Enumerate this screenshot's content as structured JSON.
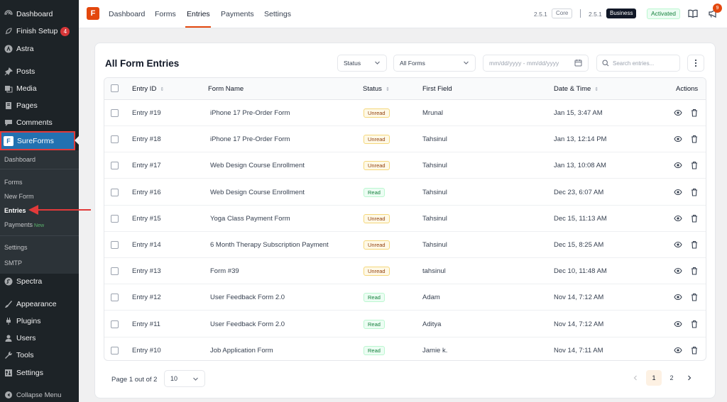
{
  "sidebar": {
    "items": [
      {
        "label": "Dashboard",
        "icon": "dashboard-icon"
      },
      {
        "label": "Finish Setup",
        "icon": "rocket-icon",
        "badge": "4"
      },
      {
        "label": "Astra",
        "icon": "astra-icon"
      },
      {
        "label": "Posts",
        "icon": "pin-icon"
      },
      {
        "label": "Media",
        "icon": "media-icon"
      },
      {
        "label": "Pages",
        "icon": "page-icon"
      },
      {
        "label": "Comments",
        "icon": "comment-icon"
      }
    ],
    "active": {
      "label": "SureForms",
      "icon": "sureforms-icon"
    },
    "submenu": {
      "dashboard": "Dashboard",
      "forms": "Forms",
      "new_form": "New Form",
      "entries": "Entries",
      "payments": "Payments",
      "payments_tag": "New",
      "settings": "Settings",
      "smtp": "SMTP"
    },
    "lower_items": [
      {
        "label": "Spectra",
        "icon": "spectra-icon"
      },
      {
        "label": "Appearance",
        "icon": "brush-icon"
      },
      {
        "label": "Plugins",
        "icon": "plugin-icon"
      },
      {
        "label": "Users",
        "icon": "users-icon"
      },
      {
        "label": "Tools",
        "icon": "wrench-icon"
      },
      {
        "label": "Settings",
        "icon": "settings-icon"
      },
      {
        "label": "Collapse Menu",
        "icon": "collapse-icon"
      }
    ]
  },
  "topbar": {
    "nav": [
      "Dashboard",
      "Forms",
      "Entries",
      "Payments",
      "Settings"
    ],
    "active_nav": "Entries",
    "core_version": "2.5.1",
    "core_label": "Core",
    "biz_version": "2.5.1",
    "biz_label": "Business",
    "status": "Activated",
    "notifications": "9",
    "accent": "#e3470d"
  },
  "entries": {
    "title": "All Form Entries",
    "filters": {
      "status": "Status",
      "forms": "All Forms",
      "date_placeholder": "mm/dd/yyyy - mm/dd/yyyy",
      "search_placeholder": "Search entries..."
    },
    "columns": {
      "id": "Entry ID",
      "form": "Form Name",
      "status": "Status",
      "first": "First Field",
      "date": "Date & Time",
      "actions": "Actions"
    },
    "rows": [
      {
        "id": "Entry #19",
        "form": "iPhone 17 Pre-Order Form",
        "status": "Unread",
        "first": "Mrunal",
        "date": "Jan 15, 3:47 AM"
      },
      {
        "id": "Entry #18",
        "form": "iPhone 17 Pre-Order Form",
        "status": "Unread",
        "first": "Tahsinul",
        "date": "Jan 13, 12:14 PM"
      },
      {
        "id": "Entry #17",
        "form": "Web Design Course Enrollment",
        "status": "Unread",
        "first": "Tahsinul",
        "date": "Jan 13, 10:08 AM"
      },
      {
        "id": "Entry #16",
        "form": "Web Design Course Enrollment",
        "status": "Read",
        "first": "Tahsinul",
        "date": "Dec 23, 6:07 AM"
      },
      {
        "id": "Entry #15",
        "form": "Yoga Class Payment Form",
        "status": "Unread",
        "first": "Tahsinul",
        "date": "Dec 15, 11:13 AM"
      },
      {
        "id": "Entry #14",
        "form": "6 Month Therapy Subscription Payment",
        "status": "Unread",
        "first": "Tahsinul",
        "date": "Dec 15, 8:25 AM"
      },
      {
        "id": "Entry #13",
        "form": "Form #39",
        "status": "Unread",
        "first": "tahsinul",
        "date": "Dec 10, 11:48 AM"
      },
      {
        "id": "Entry #12",
        "form": "User Feedback Form 2.0",
        "status": "Read",
        "first": "Adam",
        "date": "Nov 14, 7:12 AM"
      },
      {
        "id": "Entry #11",
        "form": "User Feedback Form 2.0",
        "status": "Read",
        "first": "Aditya",
        "date": "Nov 14, 7:12 AM"
      },
      {
        "id": "Entry #10",
        "form": "Job Application Form",
        "status": "Read",
        "first": "Jamie k.",
        "date": "Nov 14, 7:11 AM"
      }
    ],
    "pagination": {
      "summary": "Page 1 out of 2",
      "per_page": "10",
      "pages": [
        "1",
        "2"
      ],
      "current": "1"
    }
  }
}
